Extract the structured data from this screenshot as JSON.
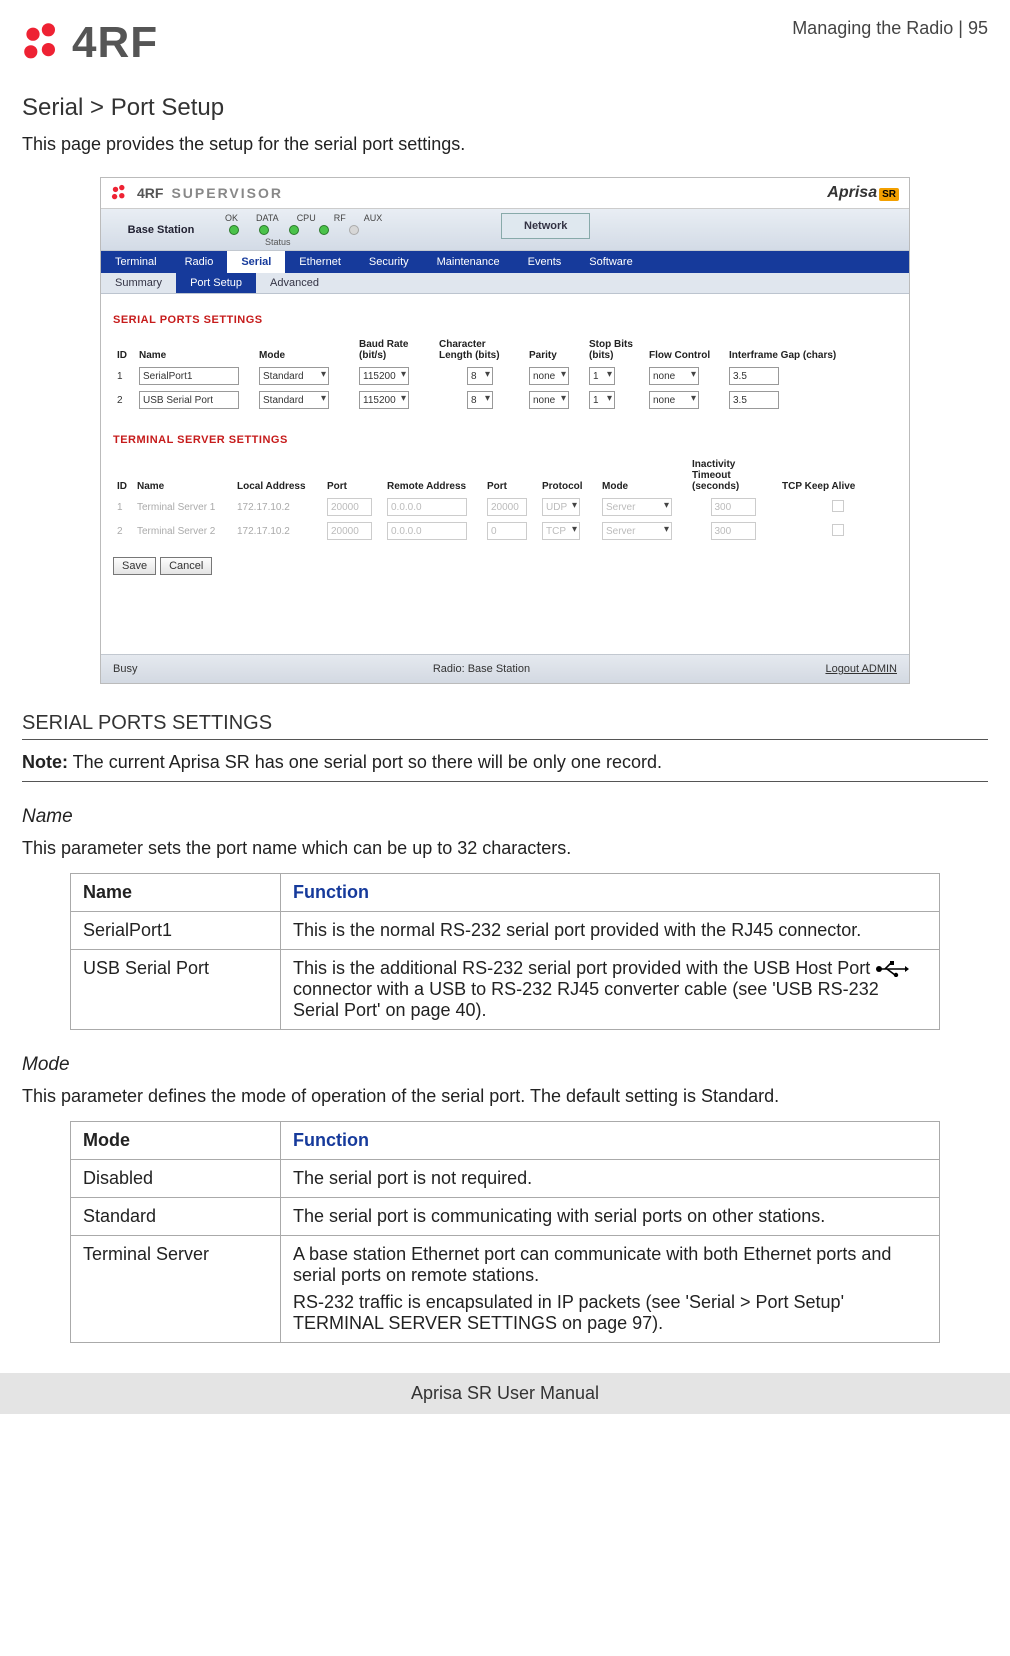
{
  "header": {
    "logo_text": "4RF",
    "crumb": "Managing the Radio  |  95"
  },
  "title": "Serial > Port Setup",
  "lead": "This page provides the setup for the serial port settings.",
  "shot": {
    "brand_supervisor": "SUPERVISOR",
    "aprisa": "Aprisa",
    "aprisa_sr": "SR",
    "base_station": "Base Station",
    "led_labels": [
      "OK",
      "DATA",
      "CPU",
      "RF",
      "AUX"
    ],
    "status_label": "Status",
    "network_btn": "Network",
    "mainnav": [
      "Terminal",
      "Radio",
      "Serial",
      "Ethernet",
      "Security",
      "Maintenance",
      "Events",
      "Software"
    ],
    "mainnav_active": "Serial",
    "subnav": [
      "Summary",
      "Port Setup",
      "Advanced"
    ],
    "subnav_active": "Port Setup",
    "serial_section_title": "SERIAL PORTS SETTINGS",
    "serial_cols": [
      "ID",
      "Name",
      "Mode",
      "Baud Rate (bit/s)",
      "Character Length (bits)",
      "Parity",
      "Stop Bits (bits)",
      "Flow Control",
      "Interframe Gap (chars)"
    ],
    "serial_rows": [
      {
        "id": "1",
        "name": "SerialPort1",
        "mode": "Standard",
        "baud": "115200",
        "charlen": "8",
        "parity": "none",
        "stop": "1",
        "flow": "none",
        "gap": "3.5"
      },
      {
        "id": "2",
        "name": "USB Serial Port",
        "mode": "Standard",
        "baud": "115200",
        "charlen": "8",
        "parity": "none",
        "stop": "1",
        "flow": "none",
        "gap": "3.5"
      }
    ],
    "term_section_title": "TERMINAL SERVER SETTINGS",
    "term_cols": [
      "ID",
      "Name",
      "Local Address",
      "Port",
      "Remote Address",
      "Port",
      "Protocol",
      "Mode",
      "Inactivity Timeout (seconds)",
      "TCP Keep Alive"
    ],
    "term_rows": [
      {
        "id": "1",
        "name": "Terminal Server 1",
        "local": "172.17.10.2",
        "port": "20000",
        "remote": "0.0.0.0",
        "rport": "20000",
        "proto": "UDP",
        "mode": "Server",
        "timeout": "300"
      },
      {
        "id": "2",
        "name": "Terminal Server 2",
        "local": "172.17.10.2",
        "port": "20000",
        "remote": "0.0.0.0",
        "rport": "0",
        "proto": "TCP",
        "mode": "Server",
        "timeout": "300"
      }
    ],
    "save": "Save",
    "cancel": "Cancel",
    "footer_left": "Busy",
    "footer_center": "Radio: Base Station",
    "footer_right": "Logout ADMIN"
  },
  "sec_serial_heading": "SERIAL PORTS SETTINGS",
  "note_label": "Note:",
  "note_text": " The current Aprisa SR has one serial port so there will be only one record.",
  "name_param": "Name",
  "name_desc": "This parameter sets the port name which can be up to 32 characters.",
  "name_table": {
    "h1": "Name",
    "h2": "Function",
    "rows": [
      {
        "c1": "SerialPort1",
        "c2": "This is the normal RS-232 serial port provided with the RJ45 connector."
      },
      {
        "c1": "USB Serial Port",
        "c2a": "This is the additional RS-232 serial port provided with the USB Host Port ",
        "c2b": " connector with a USB to RS-232 RJ45 converter cable (see 'USB RS-232 Serial Port' on page 40)."
      }
    ]
  },
  "mode_param": "Mode",
  "mode_desc": "This parameter defines the mode of operation of the serial port. The default setting is Standard.",
  "mode_table": {
    "h1": "Mode",
    "h2": "Function",
    "rows": [
      {
        "c1": "Disabled",
        "c2": "The serial port is not required."
      },
      {
        "c1": "Standard",
        "c2": "The serial port is communicating with serial ports on other stations."
      },
      {
        "c1": "Terminal Server",
        "c2": "A base station Ethernet port can communicate with both Ethernet ports and serial ports on remote stations.",
        "c2extra": "RS-232 traffic is encapsulated in IP packets (see 'Serial > Port Setup' TERMINAL SERVER SETTINGS on page 97)."
      }
    ]
  },
  "footer": "Aprisa SR User Manual"
}
